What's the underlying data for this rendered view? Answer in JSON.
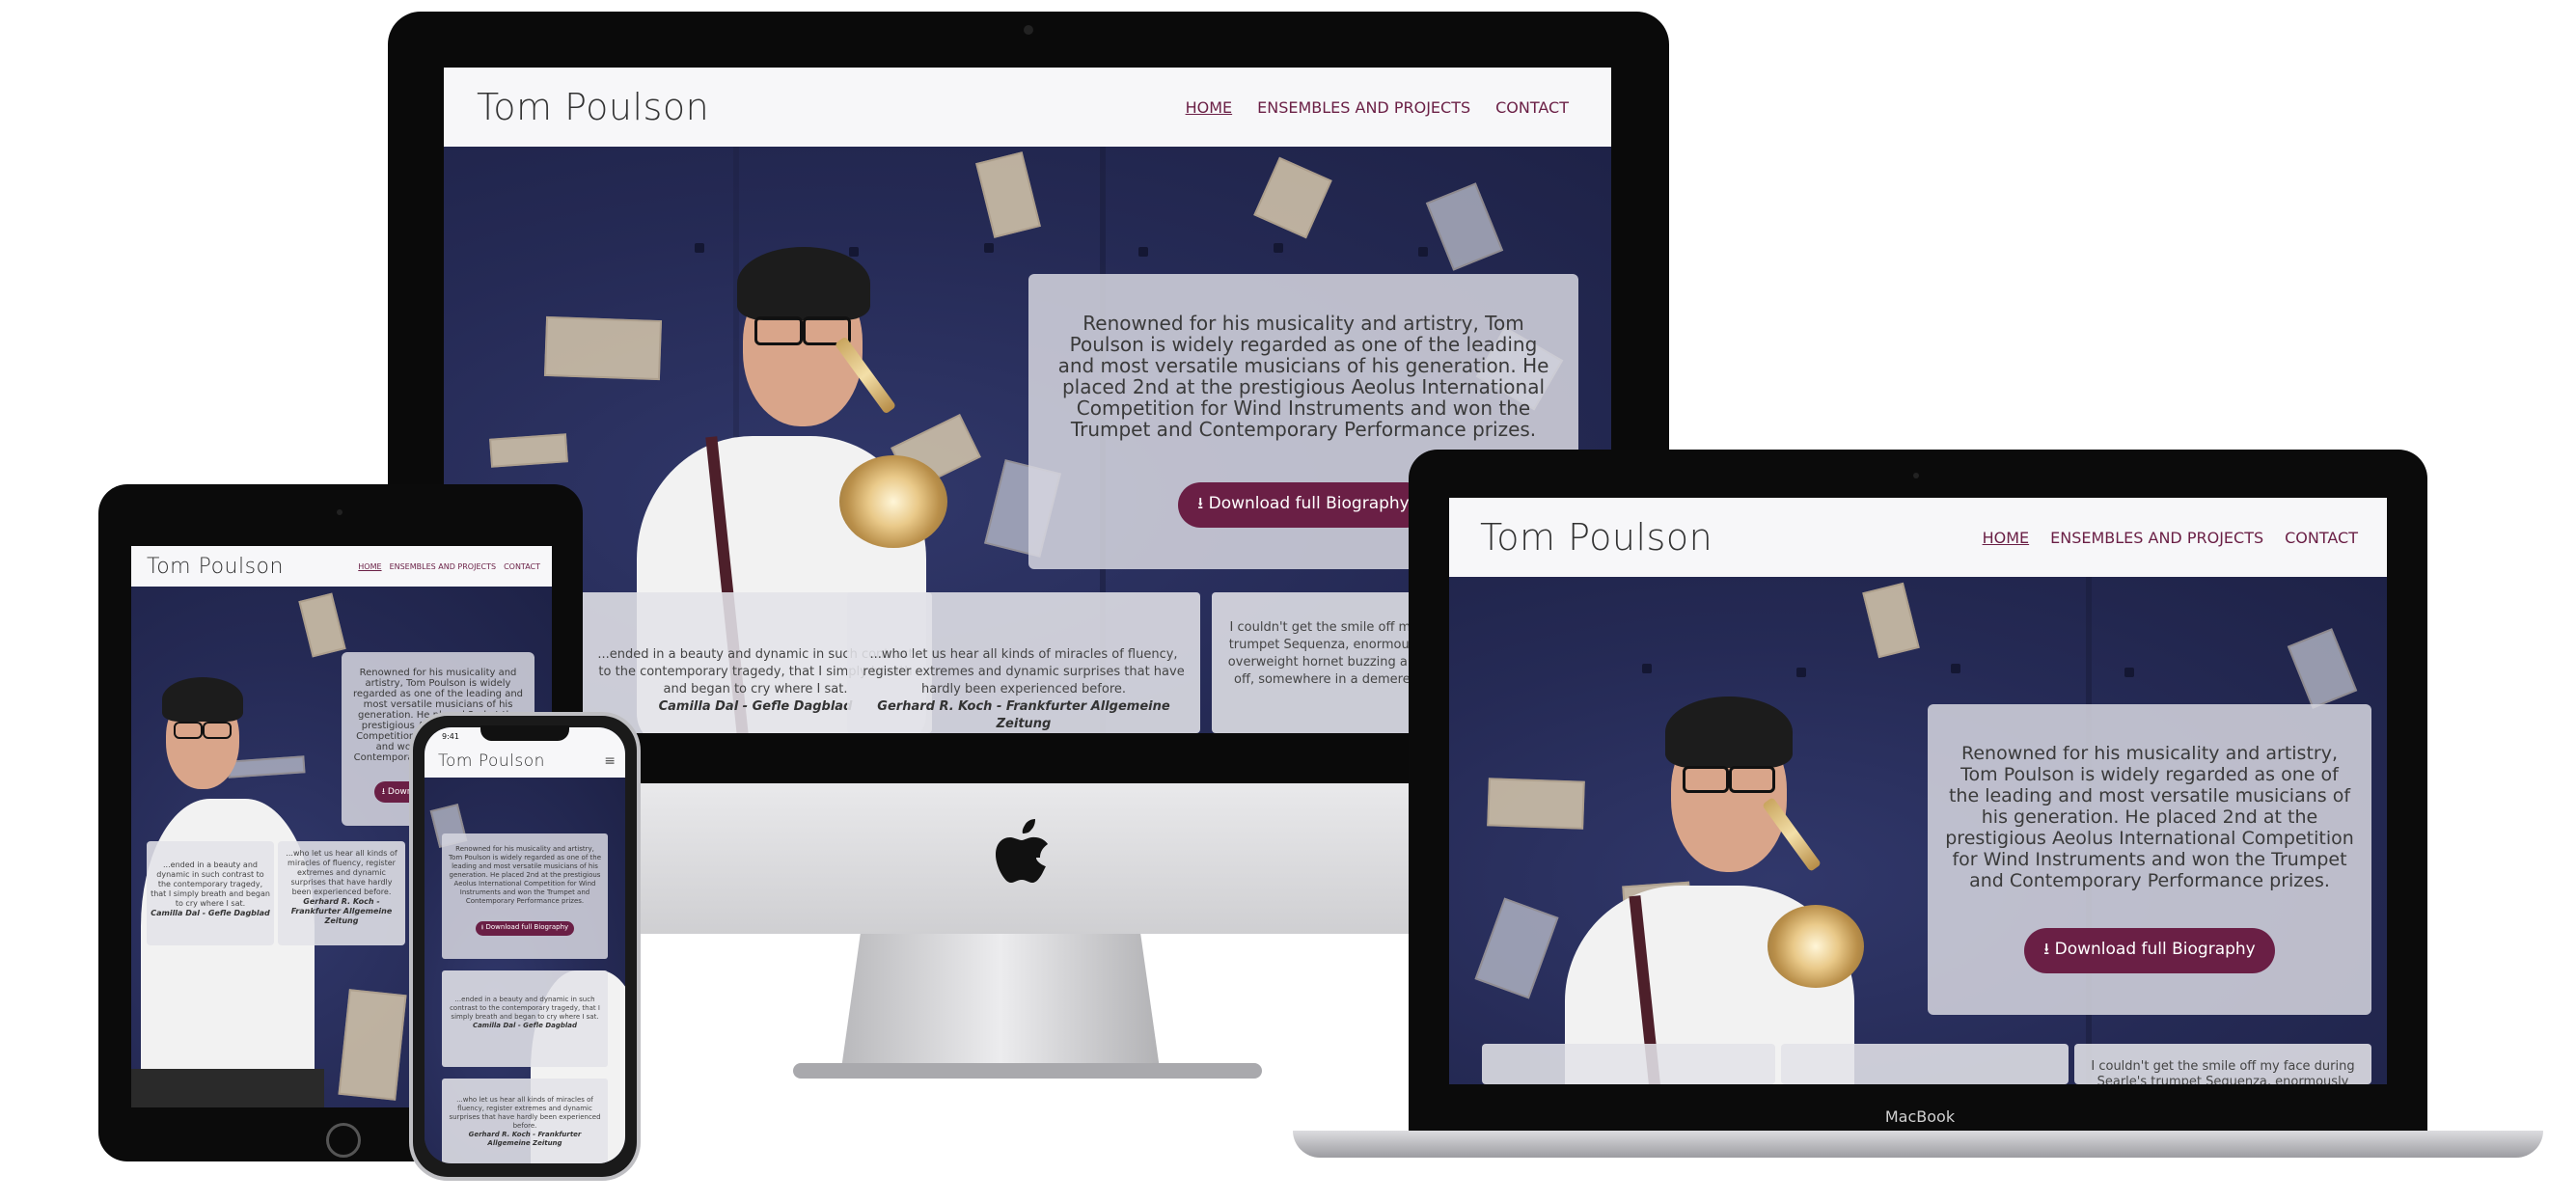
{
  "site": {
    "brand": "Tom Poulson",
    "nav": [
      {
        "label": "HOME",
        "active": true
      },
      {
        "label": "ENSEMBLES AND PROJECTS",
        "active": false
      },
      {
        "label": "CONTACT",
        "active": false
      }
    ],
    "bio": "Renowned for his musicality and artistry, Tom Poulson is widely regarded as one of the leading and most versatile musicians of his generation. He placed 2nd at the prestigious Aeolus International Competition for Wind Instruments and won the Trumpet and Contemporary Performance prizes.",
    "button_label": "Download full Biography",
    "quotes": [
      {
        "text": "...ended in a beauty and dynamic in such contrast to the contemporary tragedy, that I simply breath and began to cry where I sat.",
        "author": "Camilla Dal - Gefle Dagblad"
      },
      {
        "text": "...who let us hear all kinds of miracles of fluency, register extremes and dynamic surprises that have hardly been experienced before.",
        "author": "Gerhard R. Koch - Frankfurter Allgemeine Zeitung"
      },
      {
        "text": "I couldn't get the smile off my face during Searle's trumpet Sequenza, enormously witty, conjuring an overweight hornet buzzing and an attempted take-off, somewhere in a demere which remained fun.",
        "author": ""
      }
    ]
  },
  "phone": {
    "time": "9:41"
  },
  "laptop": {
    "label": "MacBook"
  },
  "colors": {
    "accent": "#6a1f45",
    "header_bg": "#f7f7f9",
    "hero_bg": "#262b57"
  }
}
